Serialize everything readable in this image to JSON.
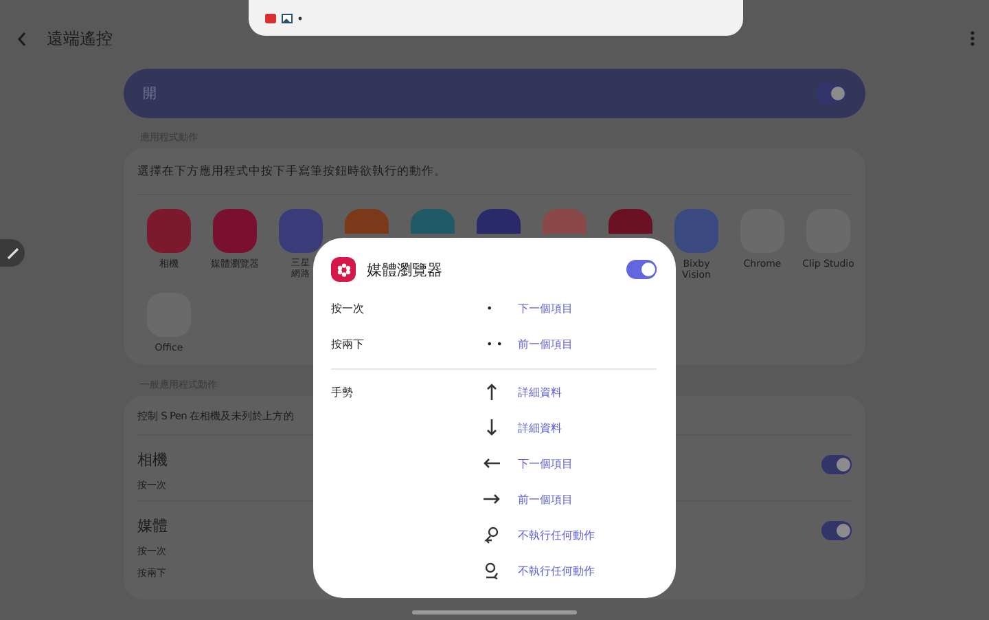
{
  "header": {
    "title": "遠端遙控"
  },
  "master_switch": {
    "label": "開",
    "on": true
  },
  "apps_section": {
    "label": "應用程式動作",
    "description": "選擇在下方應用程式中按下手寫筆按鈕時欲執行的動作。",
    "apps": [
      {
        "kind": "labeled",
        "label": "相機"
      },
      {
        "kind": "labeled",
        "label": "媒體瀏覽器"
      },
      {
        "kind": "labeled",
        "label": "三星網路"
      },
      {
        "kind": "covered"
      },
      {
        "kind": "covered"
      },
      {
        "kind": "covered"
      },
      {
        "kind": "covered"
      },
      {
        "kind": "covered"
      },
      {
        "kind": "labeled",
        "label": "Bixby\nVision"
      },
      {
        "kind": "labeled",
        "label": "Chrome"
      },
      {
        "kind": "labeled",
        "label": "Clip Studio"
      },
      {
        "kind": "labeled",
        "label": "Office"
      }
    ]
  },
  "general_section": {
    "label": "一般應用程式動作",
    "description": "控制 S Pen 在相機及未列於上方的",
    "items": [
      {
        "title": "相機",
        "on": true,
        "actions": [
          "按一次"
        ]
      },
      {
        "title": "媒體",
        "on": true,
        "actions": [
          "按一次",
          "按兩下"
        ]
      }
    ]
  },
  "dialog": {
    "title": "媒體瀏覽器",
    "on": true,
    "presses": [
      {
        "label": "按一次",
        "symbol": "•",
        "action": "下一個項目"
      },
      {
        "label": "按兩下",
        "symbol": "• •",
        "action": "前一個項目"
      }
    ],
    "gesture_label": "手勢",
    "gestures": [
      {
        "kind": "up",
        "action": "詳細資料"
      },
      {
        "kind": "down",
        "action": "詳細資料"
      },
      {
        "kind": "left",
        "action": "下一個項目"
      },
      {
        "kind": "right",
        "action": "前一個項目"
      },
      {
        "kind": "ccw",
        "action": "不執行任何動作"
      },
      {
        "kind": "cw",
        "action": "不執行任何動作"
      }
    ]
  }
}
